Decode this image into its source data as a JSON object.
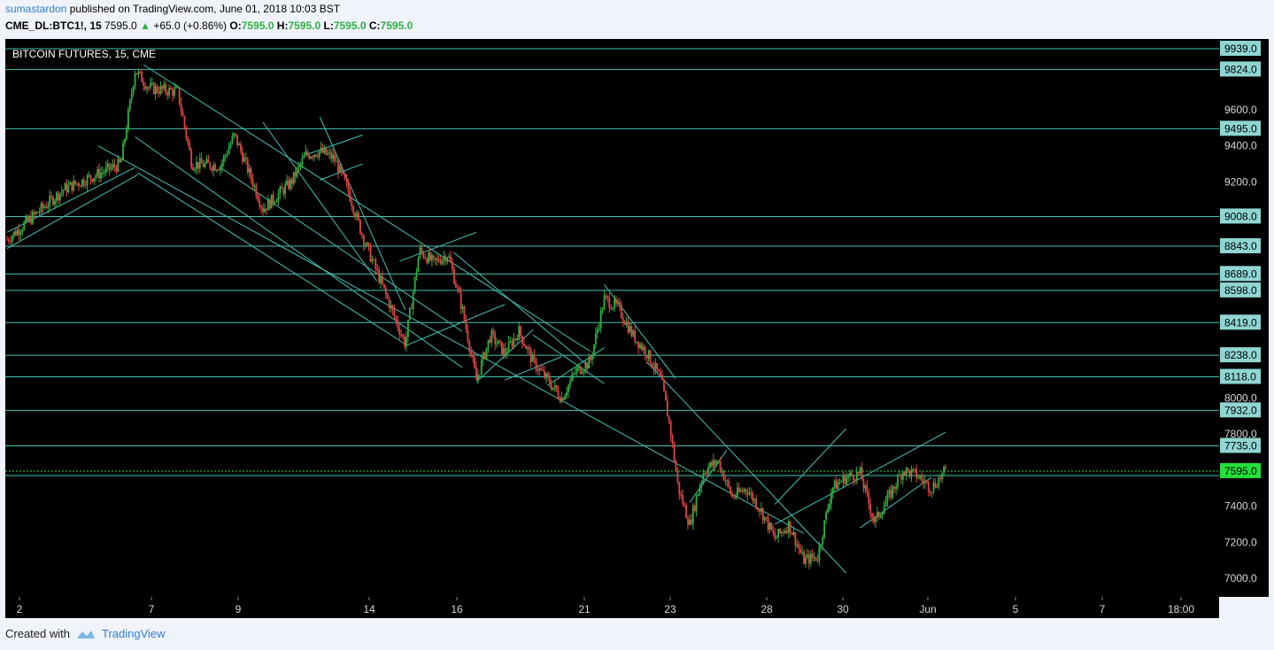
{
  "header": {
    "author": "sumastardon",
    "published_text": "published on TradingView.com, June 01, 2018 10:03 BST",
    "symbol": "CME_DL:BTC1!, 15",
    "last": "7595.0",
    "change": "+65.0 (+0.86%)",
    "o_label": "O:",
    "o": "7595.0",
    "h_label": "H:",
    "h": "7595.0",
    "l_label": "L:",
    "l": "7595.0",
    "c_label": "C:",
    "c": "7595.0"
  },
  "footer": {
    "created_with": "Created with",
    "brand": "TradingView"
  },
  "colors": {
    "background": "#000000",
    "frame": "#f0f3fa",
    "line": "#46c3b4",
    "up": "#2fb043",
    "down": "#e04545",
    "label_bg": "#8fd6d2",
    "price_bg": "#24e03a"
  },
  "chart_data": {
    "type": "candlestick",
    "title": "BITCOIN FUTURES, 15, CME",
    "x_ticks": [
      "2",
      "7",
      "9",
      "14",
      "16",
      "21",
      "23",
      "28",
      "30",
      "Jun",
      "5",
      "7",
      "18:00"
    ],
    "y_ticks": [
      9600.0,
      9400.0,
      9200.0,
      8000.0,
      7800.0,
      7400.0,
      7200.0,
      7000.0
    ],
    "y_ticks_text": [
      "9600.0",
      "9400.0",
      "9200.0",
      "8000.0",
      "7800.0",
      "7400.0",
      "7200.0",
      "7000.0"
    ],
    "ylim": [
      6950,
      10050
    ],
    "current_price": 7595.0,
    "current_price_text": "7595.0",
    "horizontal_levels": [
      9939.0,
      9824.0,
      9495.0,
      9008.0,
      8843.0,
      8689.0,
      8598.0,
      8419.0,
      8238.0,
      8118.0,
      7932.0,
      7735.0,
      7570.0
    ],
    "level_labels": [
      "9939.0",
      "9824.0",
      "9495.0",
      "9008.0",
      "8843.0",
      "8689.0",
      "8598.0",
      "8419.0",
      "8238.0",
      "8118.0",
      "7932.0",
      "7735.0"
    ],
    "price_path": [
      [
        0,
        8880
      ],
      [
        2,
        9160
      ],
      [
        3,
        9230
      ],
      [
        4,
        9300
      ],
      [
        4.5,
        9820
      ],
      [
        5,
        9720
      ],
      [
        6,
        9700
      ],
      [
        6.5,
        9300
      ],
      [
        7.5,
        9290
      ],
      [
        8,
        9460
      ],
      [
        9,
        9050
      ],
      [
        10,
        9200
      ],
      [
        10.5,
        9350
      ],
      [
        11,
        9370
      ],
      [
        11.5,
        9330
      ],
      [
        12,
        9150
      ],
      [
        12.5,
        8900
      ],
      [
        13,
        8700
      ],
      [
        13.5,
        8500
      ],
      [
        14,
        8300
      ],
      [
        14.5,
        8820
      ],
      [
        15,
        8750
      ],
      [
        15.5,
        8800
      ],
      [
        16,
        8500
      ],
      [
        16.5,
        8100
      ],
      [
        17,
        8350
      ],
      [
        17.5,
        8250
      ],
      [
        18,
        8370
      ],
      [
        18.5,
        8200
      ],
      [
        19.5,
        8000
      ],
      [
        20,
        8150
      ],
      [
        20.5,
        8200
      ],
      [
        21,
        8550
      ],
      [
        21.5,
        8500
      ],
      [
        22,
        8350
      ],
      [
        22.5,
        8250
      ],
      [
        23,
        8100
      ],
      [
        23.3,
        7850
      ],
      [
        23.6,
        7500
      ],
      [
        24,
        7300
      ],
      [
        24.5,
        7600
      ],
      [
        25,
        7650
      ],
      [
        25.5,
        7450
      ],
      [
        26,
        7500
      ],
      [
        26.5,
        7380
      ],
      [
        27,
        7220
      ],
      [
        27.5,
        7300
      ],
      [
        28,
        7100
      ],
      [
        28.5,
        7120
      ],
      [
        29,
        7500
      ],
      [
        29.5,
        7560
      ],
      [
        30,
        7580
      ],
      [
        30.5,
        7310
      ],
      [
        31,
        7450
      ],
      [
        31.5,
        7600
      ],
      [
        32,
        7570
      ],
      [
        32.5,
        7500
      ],
      [
        33,
        7595
      ]
    ],
    "trendlines": [
      [
        [
          0,
          8920
        ],
        [
          4.5,
          9280
        ]
      ],
      [
        [
          0,
          8830
        ],
        [
          4.6,
          9240
        ]
      ],
      [
        [
          4.5,
          9450
        ],
        [
          16,
          8170
        ]
      ],
      [
        [
          4.8,
          9850
        ],
        [
          20.5,
          8260
        ]
      ],
      [
        [
          3.2,
          9400
        ],
        [
          28,
          7250
        ]
      ],
      [
        [
          7.5,
          9280
        ],
        [
          16,
          8370
        ]
      ],
      [
        [
          9,
          9530
        ],
        [
          13,
          8650
        ]
      ],
      [
        [
          4.6,
          9250
        ],
        [
          14,
          8300
        ]
      ],
      [
        [
          11,
          9560
        ],
        [
          14,
          8490
        ]
      ],
      [
        [
          10.5,
          9350
        ],
        [
          12.5,
          9460
        ]
      ],
      [
        [
          11,
          9210
        ],
        [
          12.5,
          9300
        ]
      ],
      [
        [
          13.8,
          8760
        ],
        [
          16.5,
          8920
        ]
      ],
      [
        [
          14,
          8290
        ],
        [
          17.5,
          8520
        ]
      ],
      [
        [
          15.7,
          8810
        ],
        [
          20.5,
          8170
        ]
      ],
      [
        [
          16.5,
          8090
        ],
        [
          18.5,
          8380
        ]
      ],
      [
        [
          17.5,
          8100
        ],
        [
          19.5,
          8230
        ]
      ],
      [
        [
          18.5,
          8350
        ],
        [
          21,
          8080
        ]
      ],
      [
        [
          19,
          8070
        ],
        [
          21,
          8280
        ]
      ],
      [
        [
          21,
          8630
        ],
        [
          23.5,
          8110
        ]
      ],
      [
        [
          22.5,
          8200
        ],
        [
          29.5,
          7030
        ]
      ],
      [
        [
          24,
          7420
        ],
        [
          25.3,
          7710
        ]
      ],
      [
        [
          27,
          7410
        ],
        [
          29.5,
          7830
        ]
      ],
      [
        [
          30,
          7280
        ],
        [
          32.5,
          7560
        ]
      ],
      [
        [
          27,
          7300
        ],
        [
          33,
          7810
        ]
      ]
    ]
  }
}
